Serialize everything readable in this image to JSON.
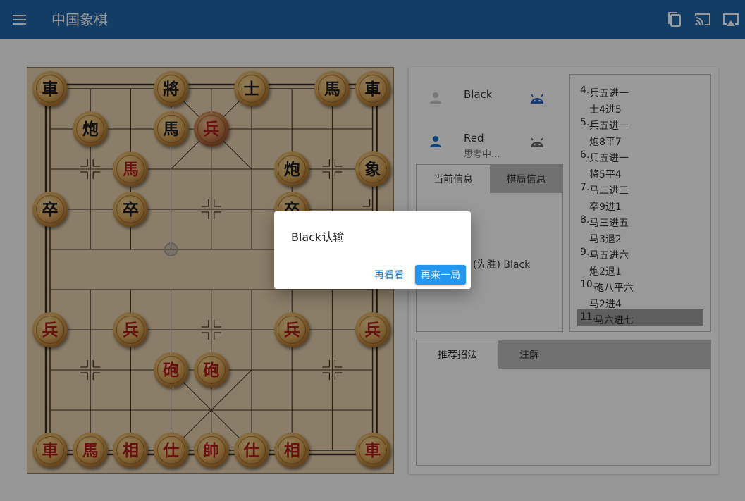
{
  "app": {
    "title": "中国象棋",
    "colors": {
      "appbar": "#2167a8",
      "primary": "#2196f3",
      "red_piece": "#b01d1d",
      "black_piece": "#1b1b1b",
      "board": "#e6d2ae"
    }
  },
  "toolbar": {
    "icons": [
      "copy-icon",
      "cast-icon",
      "airplay-icon"
    ]
  },
  "players": [
    {
      "name": "Black",
      "status": "",
      "side": "black",
      "avatar_icon": "person-icon",
      "robot_icon": "android-icon"
    },
    {
      "name": "Red",
      "status": "思考中...",
      "side": "red",
      "avatar_icon": "person-icon",
      "robot_icon": "android-icon"
    }
  ],
  "info_tabs": {
    "tabs": [
      "当前信息",
      "棋局信息"
    ],
    "active": 0,
    "result": "(先胜) Black"
  },
  "moves": {
    "list": [
      {
        "num": "4.",
        "red": "兵五进一",
        "black": "士4进5"
      },
      {
        "num": "5.",
        "red": "兵五进一",
        "black": "炮8平7"
      },
      {
        "num": "6.",
        "red": "兵五进一",
        "black": "将5平4"
      },
      {
        "num": "7.",
        "red": "马二进三",
        "black": "卒9进1"
      },
      {
        "num": "8.",
        "red": "马三进五",
        "black": "马3退2"
      },
      {
        "num": "9.",
        "red": "马五进六",
        "black": "炮2退1"
      },
      {
        "num": "10.",
        "red": "砲八平六",
        "black": "马2进4"
      },
      {
        "num": "11.",
        "red": "马六进七",
        "black": ""
      }
    ],
    "selected": 7
  },
  "bottom_tabs": {
    "tabs": [
      "推荐招法",
      "注解"
    ],
    "active": 0
  },
  "board": {
    "pieces": [
      {
        "ch": "車",
        "side": "black",
        "col": 0,
        "row": 0
      },
      {
        "ch": "將",
        "side": "black",
        "col": 3,
        "row": 0
      },
      {
        "ch": "士",
        "side": "black",
        "col": 5,
        "row": 0
      },
      {
        "ch": "馬",
        "side": "black",
        "col": 7,
        "row": 0
      },
      {
        "ch": "車",
        "side": "black",
        "col": 8,
        "row": 0
      },
      {
        "ch": "炮",
        "side": "black",
        "col": 1,
        "row": 1
      },
      {
        "ch": "馬",
        "side": "black",
        "col": 3,
        "row": 1
      },
      {
        "ch": "兵",
        "side": "red",
        "col": 4,
        "row": 1,
        "selected": true
      },
      {
        "ch": "馬",
        "side": "red",
        "col": 2,
        "row": 2
      },
      {
        "ch": "炮",
        "side": "black",
        "col": 6,
        "row": 2
      },
      {
        "ch": "象",
        "side": "black",
        "col": 8,
        "row": 2
      },
      {
        "ch": "卒",
        "side": "black",
        "col": 0,
        "row": 3
      },
      {
        "ch": "卒",
        "side": "black",
        "col": 2,
        "row": 3
      },
      {
        "ch": "卒",
        "side": "black",
        "col": 6,
        "row": 3
      },
      {
        "ch": "兵",
        "side": "red",
        "col": 0,
        "row": 6
      },
      {
        "ch": "兵",
        "side": "red",
        "col": 2,
        "row": 6
      },
      {
        "ch": "兵",
        "side": "red",
        "col": 6,
        "row": 6
      },
      {
        "ch": "兵",
        "side": "red",
        "col": 8,
        "row": 6
      },
      {
        "ch": "砲",
        "side": "red",
        "col": 3,
        "row": 7
      },
      {
        "ch": "砲",
        "side": "red",
        "col": 4,
        "row": 7
      },
      {
        "ch": "車",
        "side": "red",
        "col": 0,
        "row": 9
      },
      {
        "ch": "馬",
        "side": "red",
        "col": 1,
        "row": 9
      },
      {
        "ch": "相",
        "side": "red",
        "col": 2,
        "row": 9
      },
      {
        "ch": "仕",
        "side": "red",
        "col": 3,
        "row": 9
      },
      {
        "ch": "帥",
        "side": "red",
        "col": 4,
        "row": 9
      },
      {
        "ch": "仕",
        "side": "red",
        "col": 5,
        "row": 9
      },
      {
        "ch": "相",
        "side": "red",
        "col": 6,
        "row": 9
      },
      {
        "ch": "車",
        "side": "red",
        "col": 8,
        "row": 9
      }
    ],
    "last_move_marker": {
      "col": 3,
      "row": 4
    }
  },
  "dialog": {
    "message": "Black认输",
    "secondary": "再看看",
    "primary": "再来一局"
  }
}
